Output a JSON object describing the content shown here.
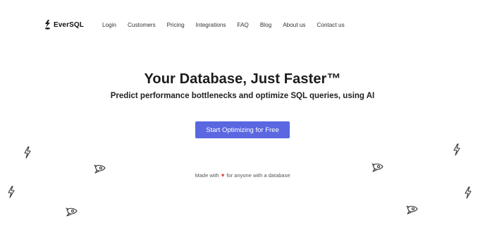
{
  "brand": {
    "name": "EverSQL"
  },
  "nav": {
    "links": [
      "Login",
      "Customers",
      "Pricing",
      "Integrations",
      "FAQ",
      "Blog",
      "About us",
      "Contact us"
    ]
  },
  "hero": {
    "title": "Your Database, Just Faster™",
    "subtitle": "Predict performance bottlenecks and optimize SQL queries, using AI",
    "cta_label": "Start Optimizing for Free"
  },
  "footer_note": {
    "prefix": "Made with",
    "heart": "♥",
    "suffix": "for anyone with a database"
  },
  "colors": {
    "accent": "#5a67e0",
    "heart": "#e0413a"
  },
  "decorations": [
    "bolt-icon",
    "rocket-icon"
  ]
}
